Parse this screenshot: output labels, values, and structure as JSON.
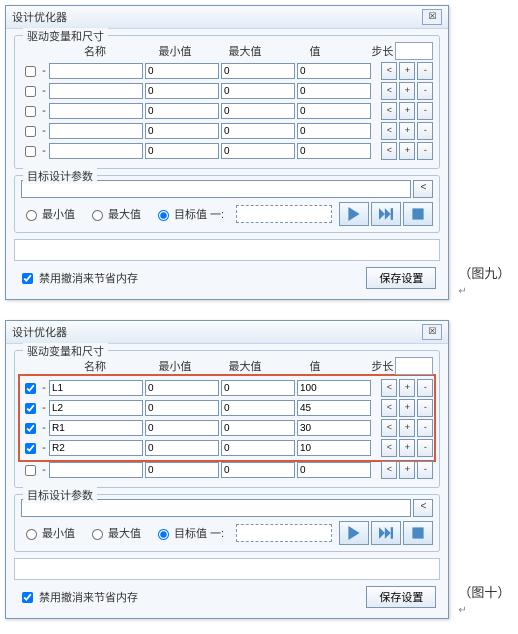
{
  "dialog_title": "设计优化器",
  "close_symbol": "☒",
  "group_vars_legend": "驱动变量和尺寸",
  "headers": {
    "name": "名称",
    "min": "最小值",
    "max": "最大值",
    "val": "值",
    "step": "步长"
  },
  "group_params_legend": "目标设计参数",
  "radios": {
    "min": "最小值",
    "max": "最大值",
    "target": "目标值 一:"
  },
  "disable_undo": "禁用撤消来节省内存",
  "save_btn": "保存设置",
  "caption9": "（图九）",
  "caption10": "（图十）",
  "return_mark": "↵",
  "btn_lt": "<",
  "btn_plus": "+",
  "btn_minus": "-",
  "panel1_rows": [
    {
      "chk": false,
      "name": "",
      "min": "0",
      "max": "0",
      "val": "0"
    },
    {
      "chk": false,
      "name": "",
      "min": "0",
      "max": "0",
      "val": "0"
    },
    {
      "chk": false,
      "name": "",
      "min": "0",
      "max": "0",
      "val": "0"
    },
    {
      "chk": false,
      "name": "",
      "min": "0",
      "max": "0",
      "val": "0"
    },
    {
      "chk": false,
      "name": "",
      "min": "0",
      "max": "0",
      "val": "0"
    }
  ],
  "panel2_rows": [
    {
      "chk": true,
      "name": "L1",
      "min": "0",
      "max": "0",
      "val": "100",
      "hl": true
    },
    {
      "chk": true,
      "name": "L2",
      "min": "0",
      "max": "0",
      "val": "45",
      "hl": true
    },
    {
      "chk": true,
      "name": "R1",
      "min": "0",
      "max": "0",
      "val": "30",
      "hl": true
    },
    {
      "chk": true,
      "name": "R2",
      "min": "0",
      "max": "0",
      "val": "10",
      "hl": true
    },
    {
      "chk": false,
      "name": "",
      "min": "0",
      "max": "0",
      "val": "0",
      "hl": false
    }
  ],
  "watermark": ""
}
